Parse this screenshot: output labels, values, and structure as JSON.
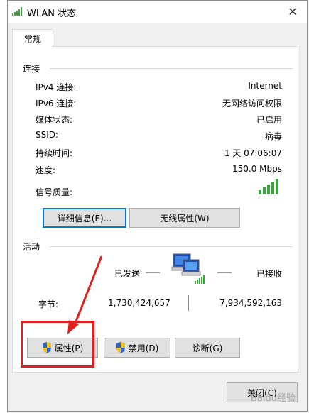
{
  "window": {
    "title": "WLAN 状态",
    "close_glyph": "✕"
  },
  "tab": {
    "label": "常规"
  },
  "connection": {
    "title": "连接",
    "rows": [
      {
        "label": "IPv4 连接:",
        "value": "Internet"
      },
      {
        "label": "IPv6 连接:",
        "value": "无网络访问权限"
      },
      {
        "label": "媒体状态:",
        "value": "已启用"
      },
      {
        "label": "SSID:",
        "value": "病毒"
      },
      {
        "label": "持续时间:",
        "value": "1 天 07:06:07"
      },
      {
        "label": "速度:",
        "value": "150.0 Mbps"
      }
    ],
    "signal_label": "信号质量:",
    "signal_bars_filled": 5,
    "signal_bars_total": 5,
    "details_button": "详细信息(E)...",
    "wireless_props_button": "无线属性(W)"
  },
  "activity": {
    "title": "活动",
    "sent_label": "已发送",
    "received_label": "已接收",
    "bytes_label": "字节:",
    "bytes_sent": "1,730,424,657",
    "bytes_received": "7,934,592,163"
  },
  "buttons": {
    "properties": "属性(P)",
    "disable": "禁用(D)",
    "diagnose": "诊断(G)",
    "close": "关闭(C)"
  },
  "watermark": "Baidu经验",
  "colors": {
    "signal_green": "#3aa53a",
    "annotation_red": "#e02020",
    "focus_blue": "#0078d7"
  },
  "icons": {
    "title": "wifi-signal-icon",
    "network": "network-computers-icon",
    "shield": "uac-shield-icon"
  }
}
